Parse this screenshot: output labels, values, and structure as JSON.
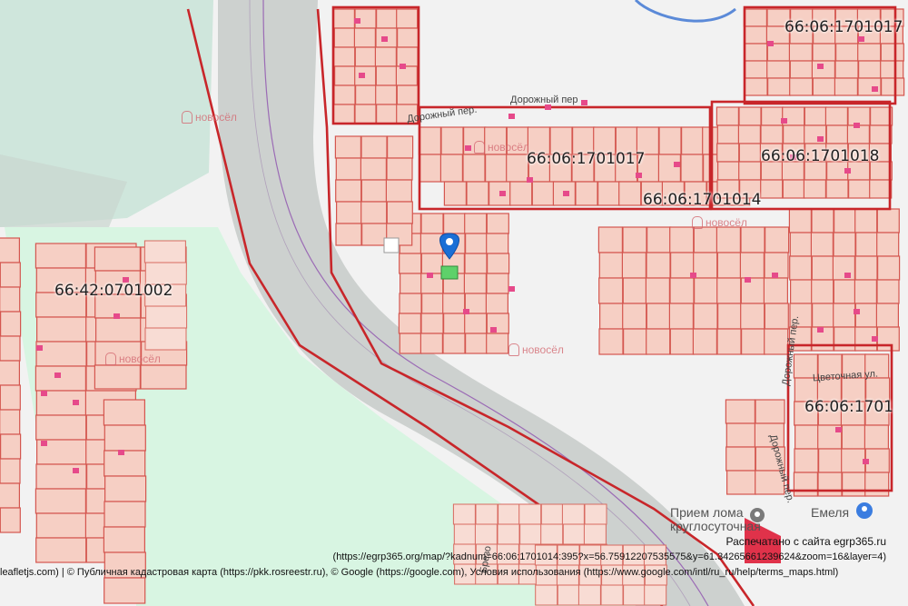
{
  "map": {
    "cadastral_numbers": {
      "top_right": "66:06:1701017",
      "block_1017": "66:06:1701017",
      "block_1018": "66:06:1701018",
      "block_1014": "66:06:1701014",
      "block_left": "66:42:0701002",
      "block_bottom_right": "66:06:1701"
    },
    "streets": {
      "dorozhny_1": "Дорожный пер.",
      "dorozhny_2": "Дорожный пер",
      "dorozhny_vertical_1": "Дорожный пер.",
      "dorozhny_vertical_2": "Дорожный пер.",
      "tsvetochnaya": "Цветочная ул.",
      "street_bottom": "Брезо"
    },
    "overlay_logos": [
      "новосёл",
      "новосёл",
      "новосёл",
      "новосёл",
      "новосёл"
    ],
    "poi": {
      "scrap": "Прием лома",
      "scrap_sub": "круглосуточная",
      "emelya": "Емеля"
    },
    "marker": {
      "icon": "map-pin-icon"
    },
    "colors": {
      "parcel_fill": "#f6cfc4",
      "parcel_stroke": "#d4564f",
      "block_stroke": "#c8262a",
      "forest": "#cfe6dc",
      "park": "#d8f5e2",
      "road": "#c7cbc8",
      "marker": "#1a6fd6",
      "selected_parcel": "#5ed16a"
    }
  },
  "attribution": {
    "printed_from": "Распечатано с сайта egrp365.ru",
    "url": "(https://egrp365.org/map/?kadnum=66:06:1701014:395?x=56.75912207535575&y=61.34265661239624&zoom=16&layer=4)",
    "sources": "leafletjs.com) | © Публичная кадастровая карта (https://pkk.rosreestr.ru), © Google (https://google.com), Условия использования (https://www.google.com/intl/ru_ru/help/terms_maps.html)"
  }
}
